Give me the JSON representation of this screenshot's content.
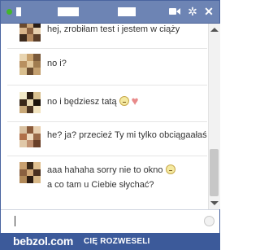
{
  "chat": {
    "messages": [
      {
        "lines": [
          "hej, zrobiłam test i jestem w ciąży"
        ]
      },
      {
        "lines": [
          "no i?"
        ]
      },
      {
        "lines": [
          "no i będziesz tatą"
        ],
        "icons": [
          "smiley-icon",
          "heart-icon"
        ]
      },
      {
        "lines": [
          "he? ja? przecież Ty mi tylko obciągaałaś"
        ]
      },
      {
        "lines": [
          "aaa hahaha sorry nie to okno",
          "a co tam u Ciebie słychać?"
        ],
        "icons": [
          "smiley-icon"
        ]
      }
    ]
  },
  "banner": {
    "brand": "bebzol.com",
    "slogan": "CIĘ ROZWESELI"
  },
  "colors": {
    "titlebar": "#6d84b4",
    "online": "#42b72a",
    "banner": "#3c5a9a"
  }
}
